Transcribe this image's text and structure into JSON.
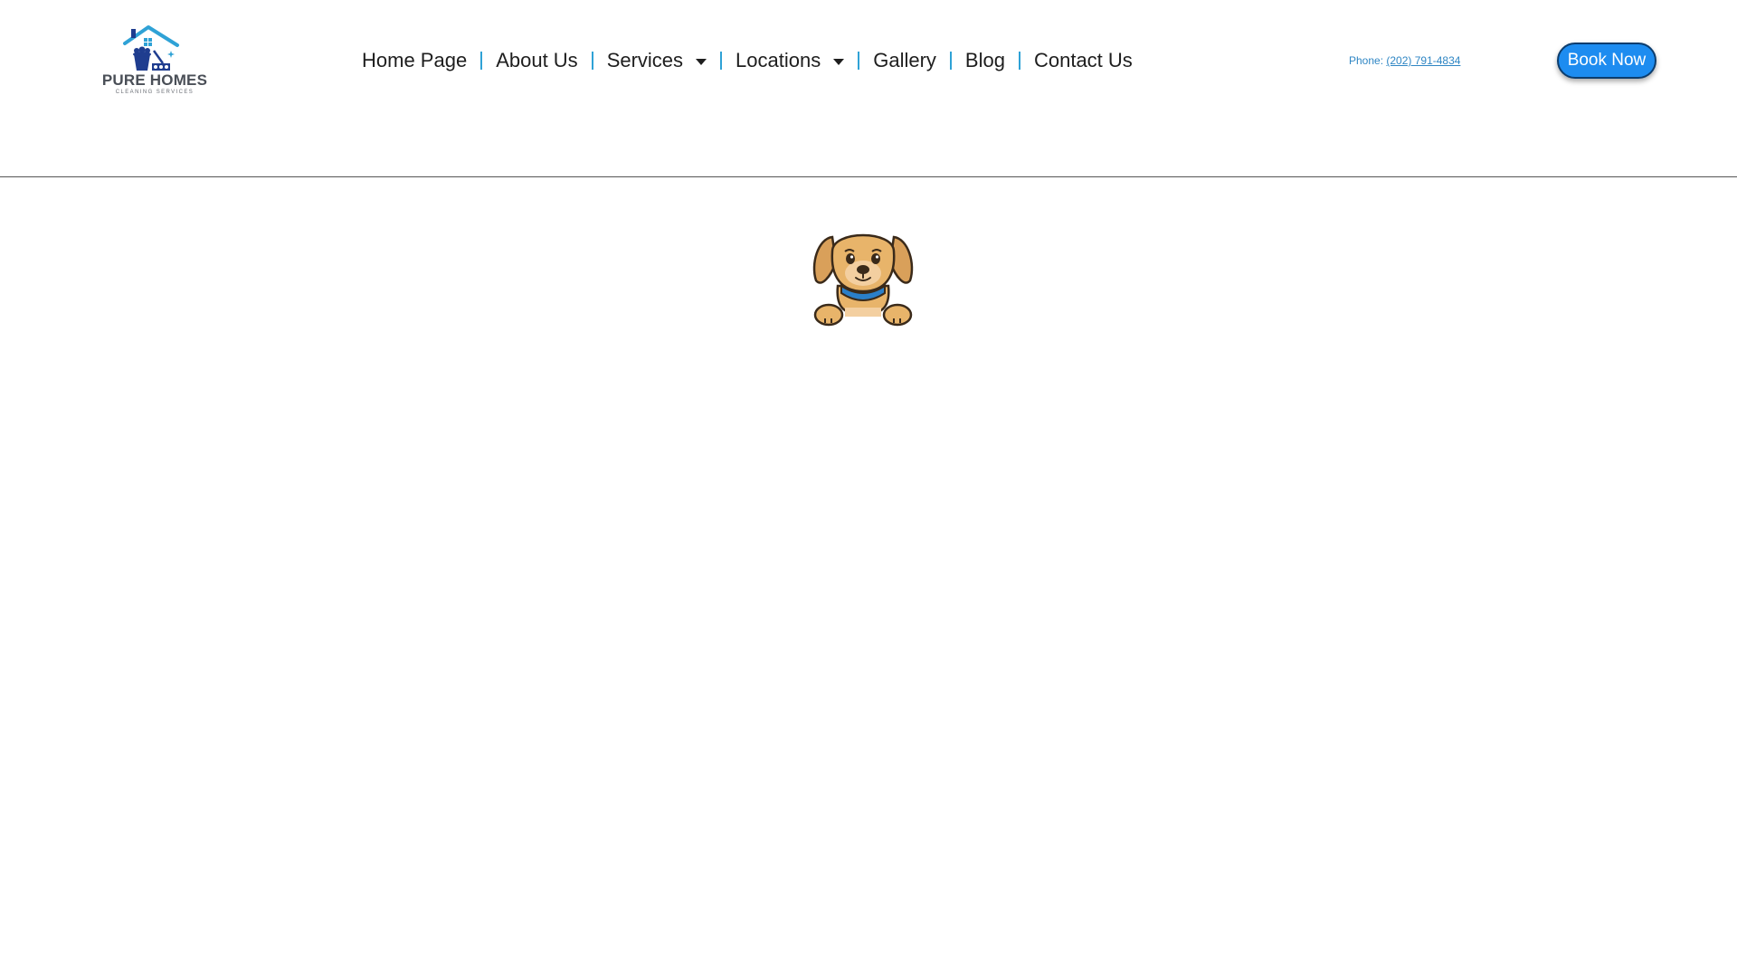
{
  "header": {
    "logo": {
      "title": "PURE HOMES",
      "subtitle": "CLEANING SERVICES",
      "icon": "house-bucket-logo"
    },
    "nav": {
      "items": [
        {
          "label": "Home Page",
          "has_dropdown": false
        },
        {
          "label": "About Us",
          "has_dropdown": false
        },
        {
          "label": "Services",
          "has_dropdown": true
        },
        {
          "label": "Locations",
          "has_dropdown": true
        },
        {
          "label": "Gallery",
          "has_dropdown": false
        },
        {
          "label": "Blog",
          "has_dropdown": false
        },
        {
          "label": "Contact Us",
          "has_dropdown": false
        }
      ]
    },
    "phone": {
      "label": "Phone: ",
      "number": "(202) 791-4834"
    },
    "book_button": {
      "label": "Book Now"
    }
  },
  "main": {
    "illustration": {
      "icon": "dog-illustration"
    }
  },
  "colors": {
    "accent": "#2fa2d6",
    "button": "#1d8cf0",
    "button_border": "#0c3d6e",
    "logo_blue": "#1f3d8f",
    "logo_light": "#2fa2d6",
    "logo_text": "#4a4f57",
    "dog_fur": "#e8b46a",
    "dog_collar": "#2a7fc9"
  }
}
